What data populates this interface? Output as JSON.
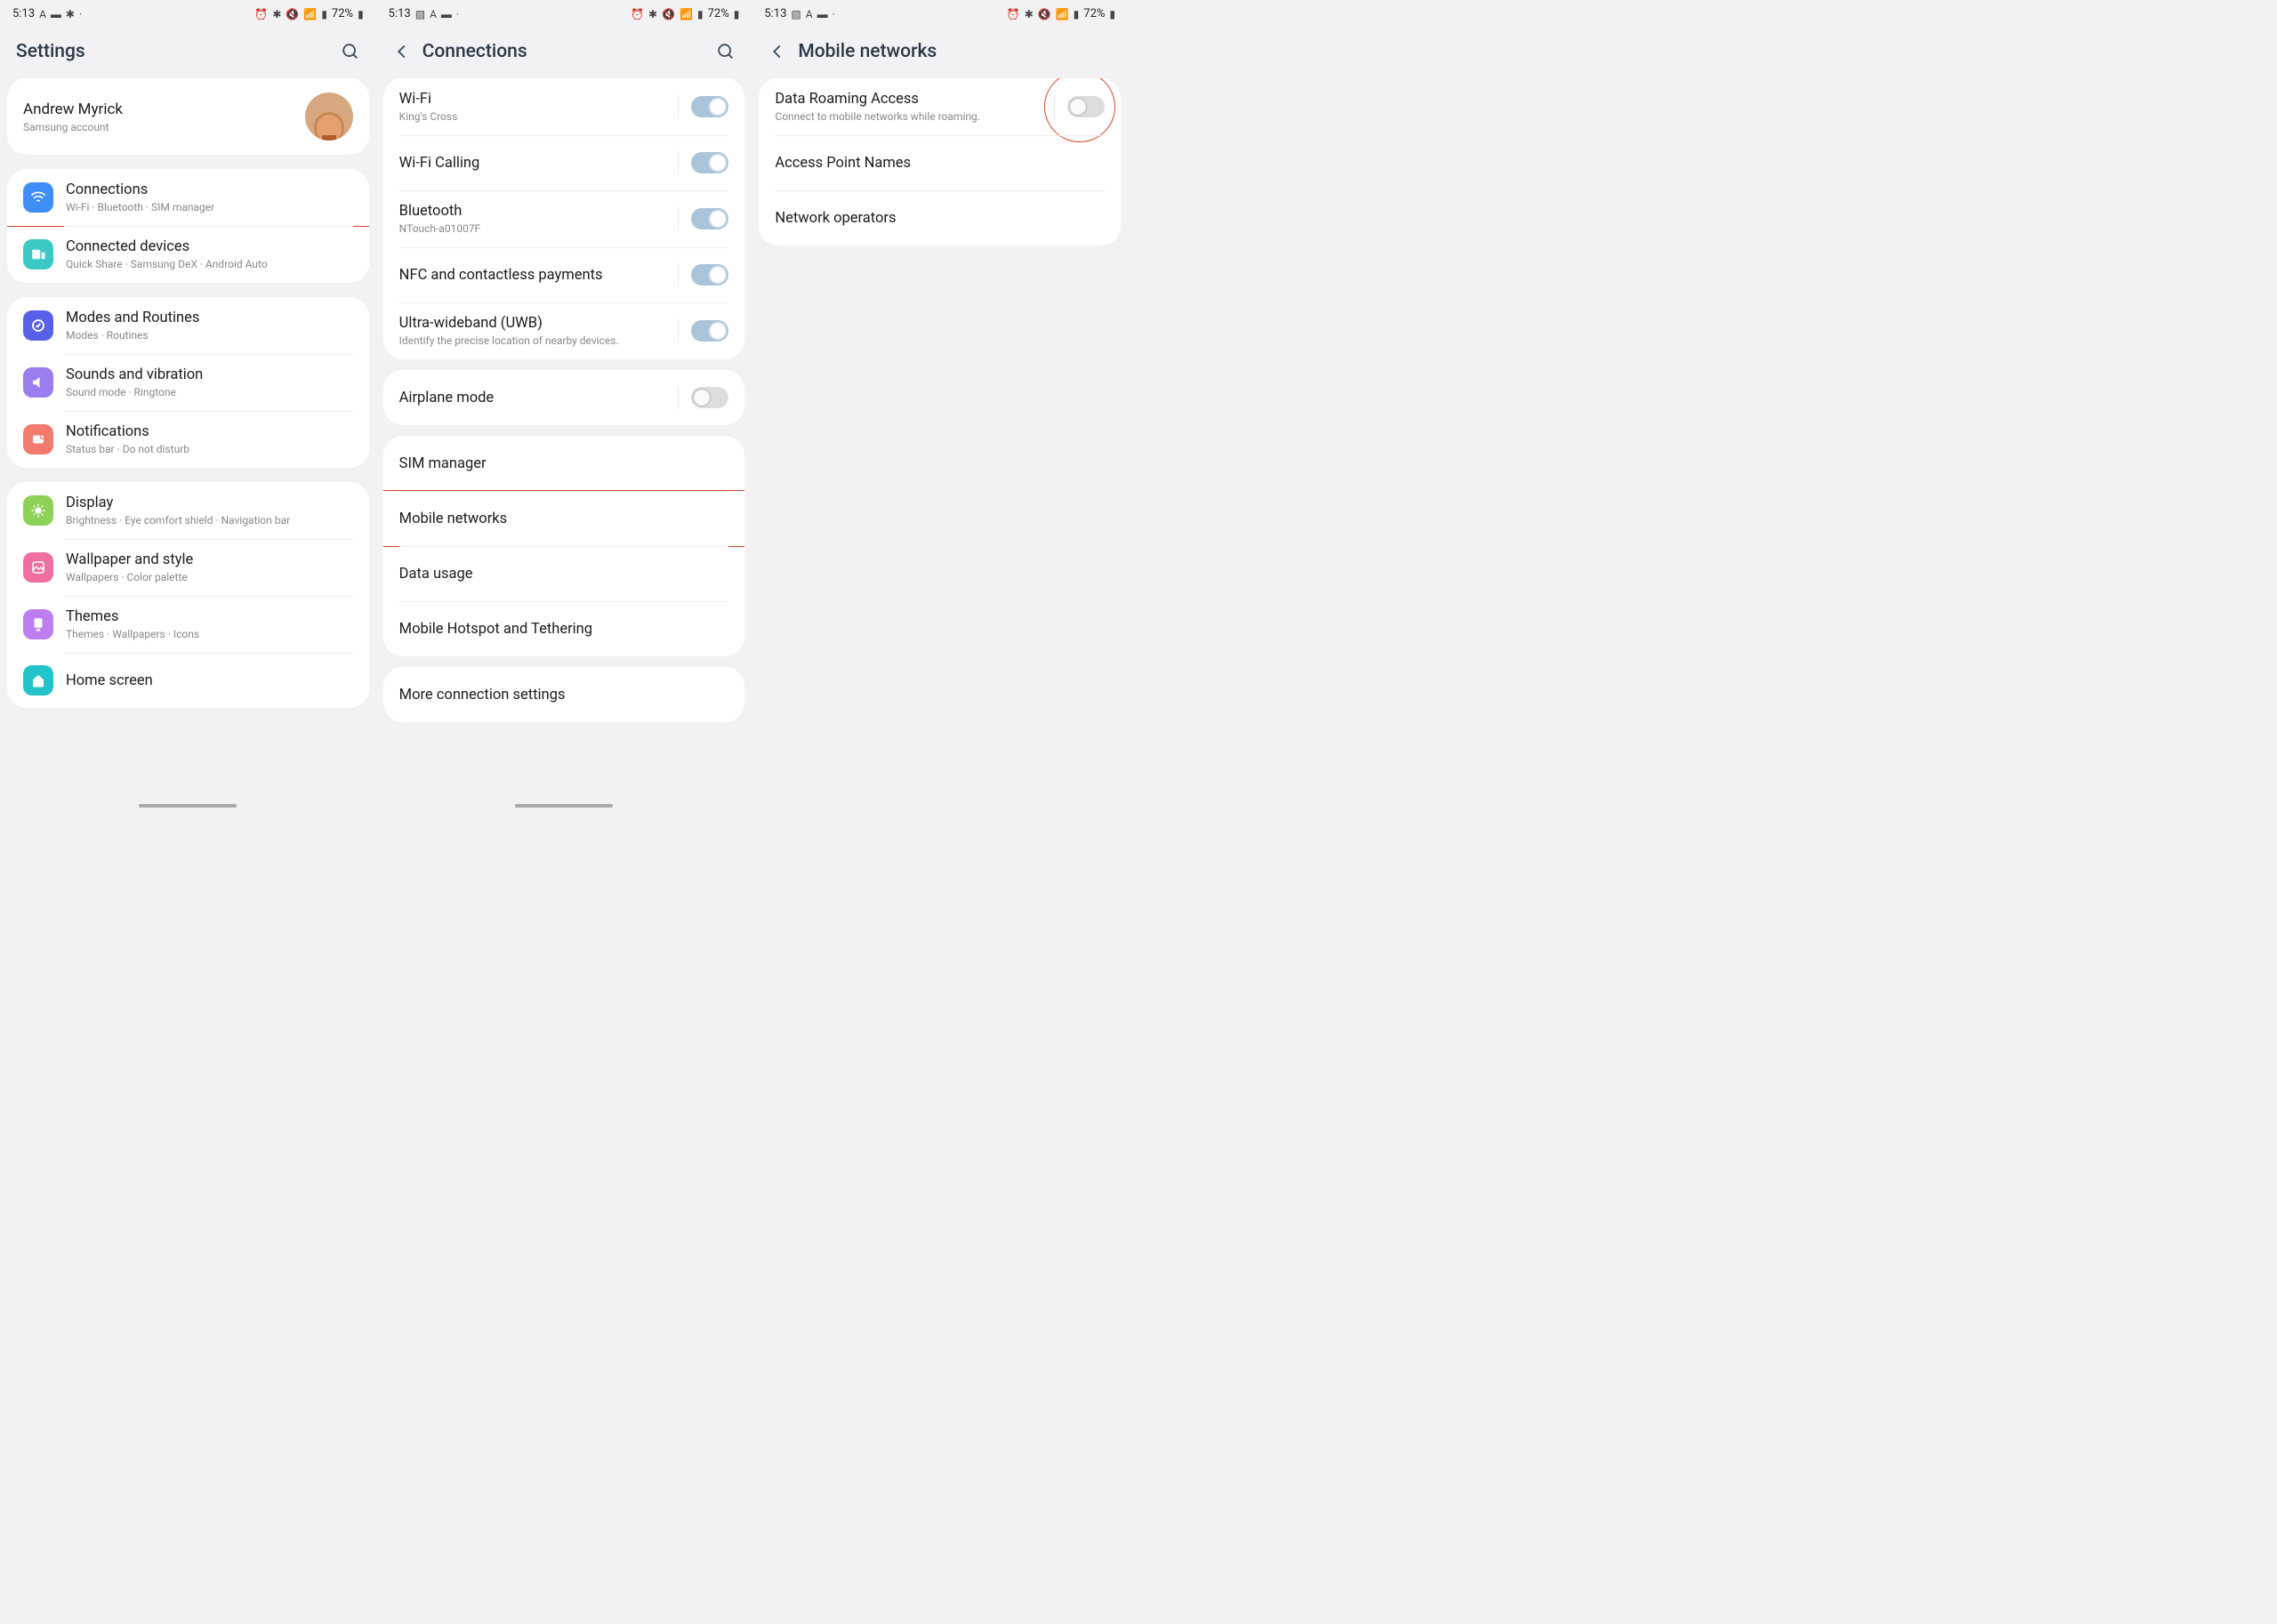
{
  "status": {
    "time": "5:13",
    "battery_pct": "72%"
  },
  "icons": {
    "navA": "A",
    "dot": "•"
  },
  "screen1": {
    "header_title": "Settings",
    "profile_name": "Andrew Myrick",
    "profile_sub": "Samsung account",
    "groups": [
      {
        "rows": [
          {
            "title": "Connections",
            "sub": "Wi-Fi  ·  Bluetooth  ·  SIM manager",
            "icon": "conn",
            "highlight": true
          },
          {
            "title": "Connected devices",
            "sub": "Quick Share  ·  Samsung DeX  ·  Android Auto",
            "icon": "cdev"
          }
        ]
      },
      {
        "rows": [
          {
            "title": "Modes and Routines",
            "sub": "Modes  ·  Routines",
            "icon": "modes"
          },
          {
            "title": "Sounds and vibration",
            "sub": "Sound mode  ·  Ringtone",
            "icon": "sound"
          },
          {
            "title": "Notifications",
            "sub": "Status bar  ·  Do not disturb",
            "icon": "notif"
          }
        ]
      },
      {
        "rows": [
          {
            "title": "Display",
            "sub": "Brightness  ·  Eye comfort shield  ·  Navigation bar",
            "icon": "disp"
          },
          {
            "title": "Wallpaper and style",
            "sub": "Wallpapers  ·  Color palette",
            "icon": "wall"
          },
          {
            "title": "Themes",
            "sub": "Themes  ·  Wallpapers  ·  Icons",
            "icon": "theme"
          },
          {
            "title": "Home screen",
            "sub": "",
            "icon": "home"
          }
        ]
      }
    ]
  },
  "screen2": {
    "header_title": "Connections",
    "group1": [
      {
        "title": "Wi-Fi",
        "sub": "King's Cross",
        "toggle": "on"
      },
      {
        "title": "Wi-Fi Calling",
        "sub": "",
        "toggle": "on"
      },
      {
        "title": "Bluetooth",
        "sub": "NTouch-a01007F",
        "toggle": "on"
      },
      {
        "title": "NFC and contactless payments",
        "sub": "",
        "toggle": "on"
      },
      {
        "title": "Ultra-wideband (UWB)",
        "sub": "Identify the precise location of nearby devices.",
        "toggle": "on"
      }
    ],
    "group2": [
      {
        "title": "Airplane mode",
        "sub": "",
        "toggle": "off"
      }
    ],
    "group3": [
      {
        "title": "SIM manager"
      },
      {
        "title": "Mobile networks",
        "highlight": true
      },
      {
        "title": "Data usage"
      },
      {
        "title": "Mobile Hotspot and Tethering"
      }
    ],
    "group4": [
      {
        "title": "More connection settings"
      }
    ]
  },
  "screen3": {
    "header_title": "Mobile networks",
    "rows": [
      {
        "title": "Data Roaming Access",
        "sub": "Connect to mobile networks while roaming.",
        "toggle": "off",
        "circle": true
      },
      {
        "title": "Access Point Names"
      },
      {
        "title": "Network operators"
      }
    ]
  }
}
